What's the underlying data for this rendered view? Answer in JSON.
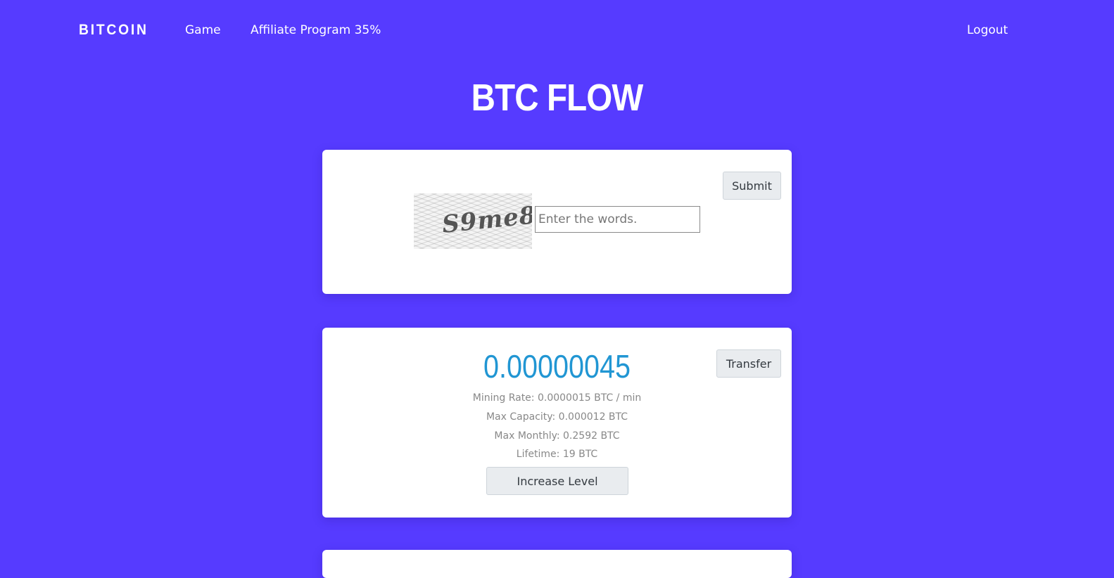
{
  "nav": {
    "brand": "BITCOIN",
    "links": [
      "Game",
      "Affiliate Program 35%"
    ],
    "logout": "Logout"
  },
  "page": {
    "title": "BTC FLOW"
  },
  "captcha": {
    "image_text": "S9me8",
    "input_placeholder": "Enter the words.",
    "input_value": "",
    "submit_label": "Submit"
  },
  "balance": {
    "amount": "0.00000045",
    "transfer_label": "Transfer",
    "mining_rate": "Mining Rate: 0.0000015 BTC / min",
    "max_capacity": "Max Capacity: 0.000012 BTC",
    "max_monthly": "Max Monthly: 0.2592 BTC",
    "lifetime": "Lifetime: 19 BTC",
    "increase_label": "Increase Level"
  },
  "colors": {
    "background": "#563bff",
    "card": "#ffffff",
    "balance_text": "#2196d3",
    "button_bg": "#e9ecef"
  }
}
